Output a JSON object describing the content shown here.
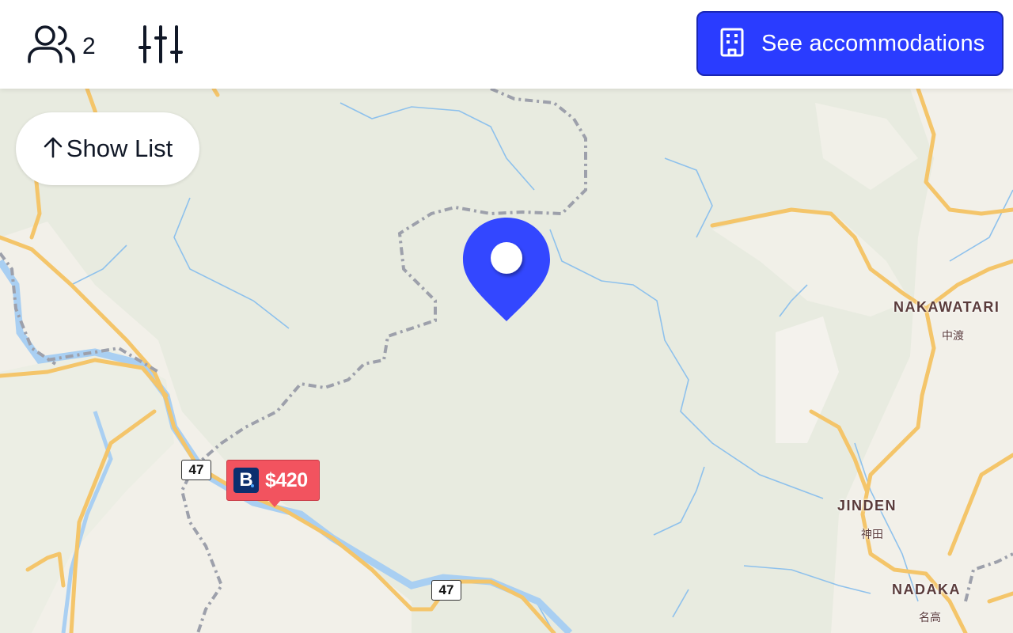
{
  "header": {
    "guests_count": "2",
    "guests_icon": "users-icon",
    "filters_icon": "sliders-icon",
    "cta_label": "See accommodations",
    "cta_icon": "building-icon",
    "cta_color": "#2a3cff"
  },
  "map_controls": {
    "show_list_label": "Show List",
    "show_list_icon": "arrow-up-icon"
  },
  "map": {
    "selected_pin_color": "#3347ff",
    "listing_marker": {
      "provider_logo_letter": "B",
      "price": "$420",
      "color": "#f2535f"
    },
    "road_shields": [
      "47",
      "47"
    ],
    "place_labels": [
      {
        "name": "NAKAWATARI",
        "sub": "中渡"
      },
      {
        "name": "JINDEN",
        "sub": "神田"
      },
      {
        "name": "NADAKA",
        "sub": "名高"
      }
    ]
  }
}
